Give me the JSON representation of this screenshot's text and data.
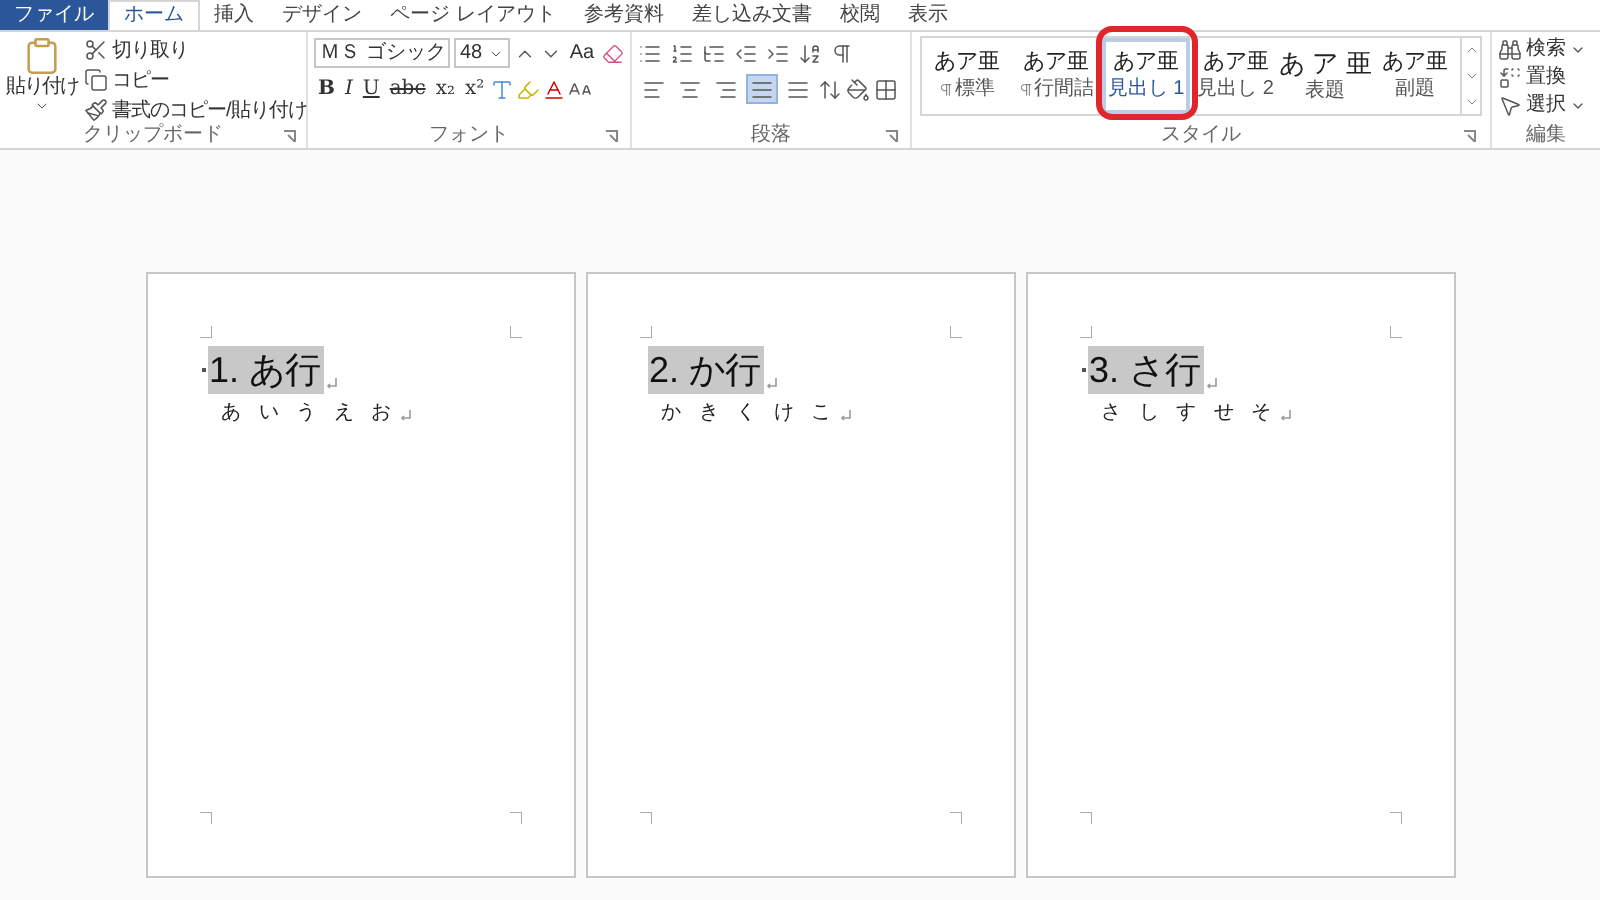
{
  "tabs": [
    {
      "label": "ファイル",
      "kind": "file",
      "selected": false
    },
    {
      "label": "ホーム",
      "kind": "tab",
      "selected": true
    },
    {
      "label": "挿入",
      "kind": "tab",
      "selected": false
    },
    {
      "label": "デザイン",
      "kind": "tab",
      "selected": false
    },
    {
      "label": "ページ レイアウト",
      "kind": "tab",
      "selected": false
    },
    {
      "label": "参考資料",
      "kind": "tab",
      "selected": false
    },
    {
      "label": "差し込み文書",
      "kind": "tab",
      "selected": false
    },
    {
      "label": "校閲",
      "kind": "tab",
      "selected": false
    },
    {
      "label": "表示",
      "kind": "tab",
      "selected": false
    }
  ],
  "clipboard": {
    "paste": "貼り付け",
    "items": [
      {
        "kind": "cut",
        "label": "切り取り"
      },
      {
        "kind": "copy",
        "label": "コピー"
      },
      {
        "kind": "format",
        "label": "書式のコピー/貼り付け"
      }
    ],
    "group_label": "クリップボード"
  },
  "font": {
    "name": "ＭＳ ゴシック",
    "size": "48",
    "case_button": "Aa",
    "format_buttons": [
      "B",
      "I",
      "U",
      "abc",
      "x₂",
      "x²"
    ],
    "group_label": "フォント"
  },
  "paragraph": {
    "alignments": [
      {
        "kind": "left",
        "selected": false
      },
      {
        "kind": "center",
        "selected": false
      },
      {
        "kind": "right",
        "selected": false
      },
      {
        "kind": "justify",
        "selected": true
      },
      {
        "kind": "distributed",
        "selected": false
      }
    ],
    "group_label": "段落"
  },
  "styles": {
    "items": [
      {
        "sample": "あア亜",
        "label": "標準",
        "kind": "paragraph",
        "selected": false
      },
      {
        "sample": "あア亜",
        "label": "行間詰",
        "kind": "paragraph",
        "selected": false
      },
      {
        "sample": "あア亜",
        "label": "見出し 1",
        "kind": "linked",
        "selected": true
      },
      {
        "sample": "あア亜",
        "label": "見出し 2",
        "kind": "linked",
        "selected": false
      },
      {
        "sample": "あ ア 亜",
        "label": "表題",
        "kind": "title",
        "selected": false
      },
      {
        "sample": "あア亜",
        "label": "副題",
        "kind": "linked",
        "selected": false
      }
    ],
    "group_label": "スタイル"
  },
  "editing": {
    "items": [
      {
        "kind": "find",
        "label": "検索",
        "dropdown": true
      },
      {
        "kind": "replace",
        "label": "置換",
        "dropdown": false
      },
      {
        "kind": "select",
        "label": "選択",
        "dropdown": true
      }
    ],
    "group_label": "編集"
  },
  "pages": [
    {
      "heading": "1. あ行",
      "body": "あ い う え お",
      "keep_mark": true
    },
    {
      "heading": "2. か行",
      "body": "か き く け こ",
      "keep_mark": false
    },
    {
      "heading": "3. さ行",
      "body": "さ し す せ そ",
      "keep_mark": true
    }
  ]
}
